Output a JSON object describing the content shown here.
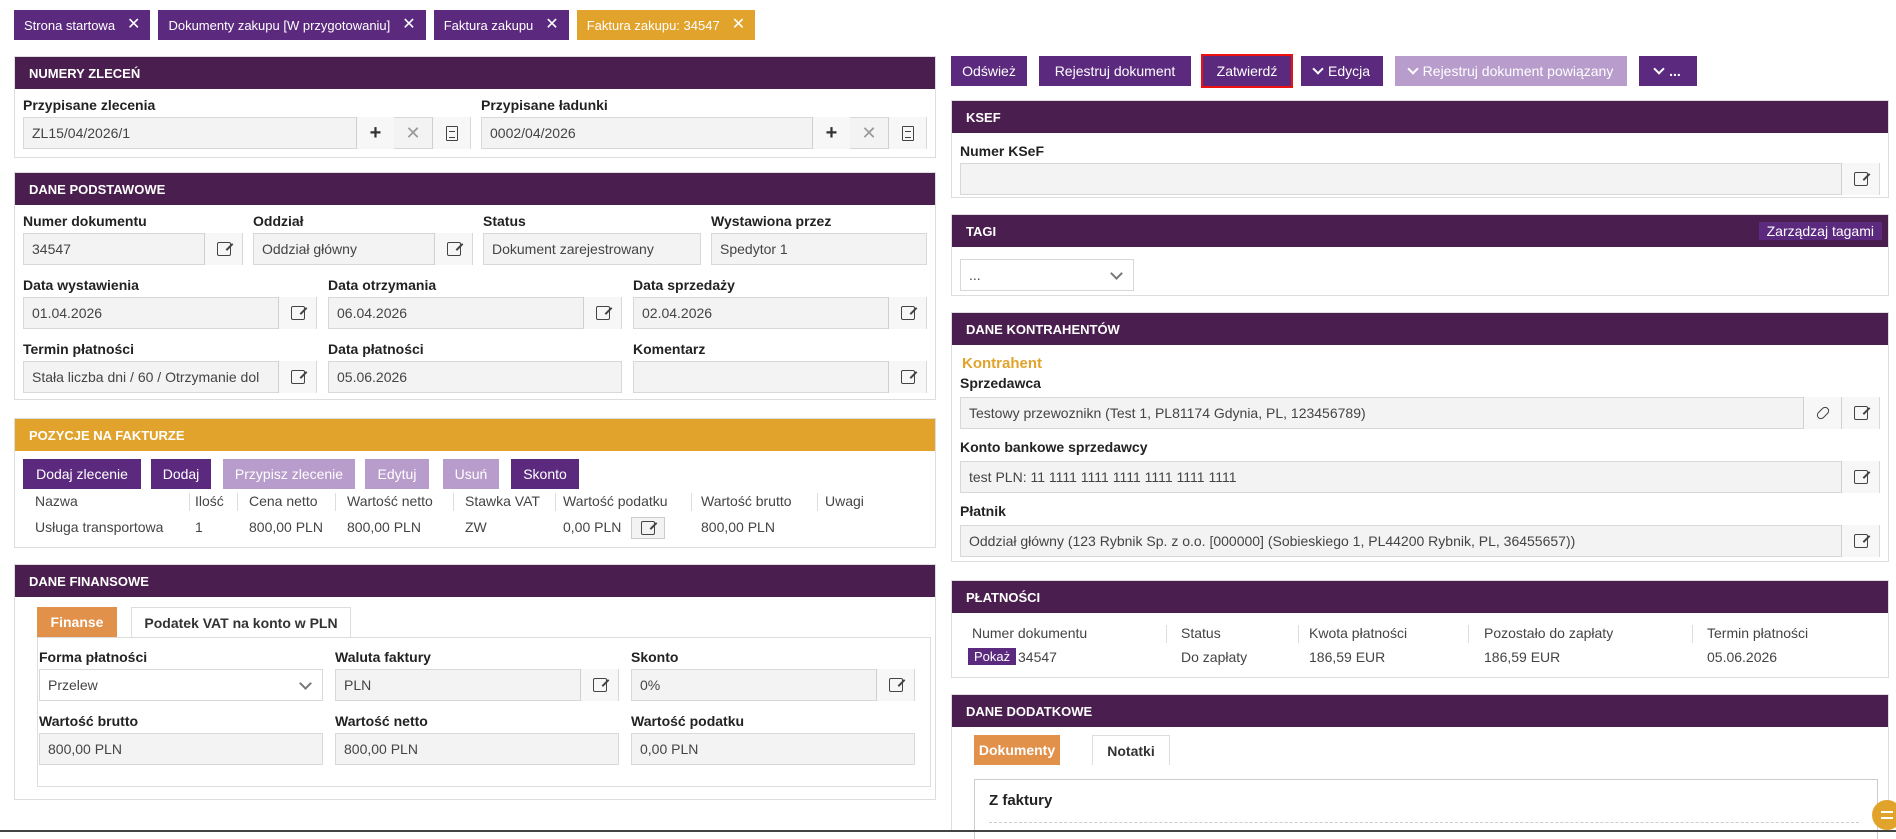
{
  "tabs": [
    {
      "label": "Strona startowa"
    },
    {
      "label": "Dokumenty zakupu [W przygotowaniu]"
    },
    {
      "label": "Faktura zakupu"
    },
    {
      "label": "Faktura zakupu: 34547"
    }
  ],
  "close_glyph": "✕",
  "numery": {
    "title": "NUMERY ZLECEŃ",
    "zlecenia_label": "Przypisane zlecenia",
    "zlecenia_value": "ZL15/04/2026/1",
    "ladunki_label": "Przypisane ładunki",
    "ladunki_value": "0002/04/2026"
  },
  "podstawowe": {
    "title": "DANE PODSTAWOWE",
    "numer_label": "Numer dokumentu",
    "numer_value": "34547",
    "oddzial_label": "Oddział",
    "oddzial_value": "Oddział główny",
    "status_label": "Status",
    "status_value": "Dokument zarejestrowany",
    "wystawiona_label": "Wystawiona przez",
    "wystawiona_value": "Spedytor 1",
    "dw_label": "Data wystawienia",
    "dw_value": "01.04.2026",
    "do_label": "Data otrzymania",
    "do_value": "06.04.2026",
    "ds_label": "Data sprzedaży",
    "ds_value": "02.04.2026",
    "tp_label": "Termin płatności",
    "tp_value": "Stała liczba dni / 60 / Otrzymanie dol",
    "dp_label": "Data płatności",
    "dp_value": "05.06.2026",
    "kom_label": "Komentarz",
    "kom_value": ""
  },
  "pozycje": {
    "title": "POZYCJE NA FAKTURZE",
    "buttons": [
      "Dodaj zlecenie",
      "Dodaj",
      "Przypisz zlecenie",
      "Edytuj",
      "Usuń",
      "Skonto"
    ],
    "headers": [
      "Nazwa",
      "Ilość",
      "Cena netto",
      "Wartość netto",
      "Stawka VAT",
      "Wartość podatku",
      "Wartość brutto",
      "Uwagi"
    ],
    "row": [
      "Usługa transportowa",
      "1",
      "800,00 PLN",
      "800,00 PLN",
      "ZW",
      "0,00 PLN",
      "800,00 PLN",
      ""
    ]
  },
  "finansowe": {
    "title": "DANE FINANSOWE",
    "tab1": "Finanse",
    "tab2": "Podatek VAT na konto w PLN",
    "forma_label": "Forma płatności",
    "forma_value": "Przelew",
    "waluta_label": "Waluta faktury",
    "waluta_value": "PLN",
    "skonto_label": "Skonto",
    "skonto_value": "0%",
    "brutto_label": "Wartość brutto",
    "brutto_value": "800,00 PLN",
    "netto_label": "Wartość netto",
    "netto_value": "800,00 PLN",
    "podatek_label": "Wartość podatku",
    "podatek_value": "0,00 PLN"
  },
  "toolbar": {
    "odswiez": "Odśwież",
    "rejestruj": "Rejestruj dokument",
    "zatwierdz": "Zatwierdź",
    "edycja": "Edycja",
    "powiazany": "Rejestruj dokument powiązany",
    "more": "..."
  },
  "ksef": {
    "title": "KSEF",
    "label": "Numer KSeF",
    "value": ""
  },
  "tagi": {
    "title": "TAGI",
    "manage": "Zarządzaj tagami",
    "select": "..."
  },
  "kontrahenci": {
    "title": "DANE KONTRAHENTÓW",
    "section": "Kontrahent",
    "sprzedawca_label": "Sprzedawca",
    "sprzedawca_value": "Testowy przewoznikn (Test 1, PL81174 Gdynia, PL, 123456789)",
    "konto_label": "Konto bankowe sprzedawcy",
    "konto_value": "test PLN: 11 1111 1111 1111 1111 1111 1111",
    "platnik_label": "Płatnik",
    "platnik_value": "Oddział główny (123 Rybnik Sp. z o.o. [000000] (Sobieskiego 1, PL44200 Rybnik, PL, 36455657))"
  },
  "platnosci": {
    "title": "PŁATNOŚCI",
    "headers": [
      "Numer dokumentu",
      "Status",
      "Kwota płatności",
      "Pozostało do zapłaty",
      "Termin płatności"
    ],
    "show": "Pokaż",
    "row": [
      "34547",
      "Do zapłaty",
      "186,59 EUR",
      "186,59 EUR",
      "05.06.2026"
    ]
  },
  "dodatkowe": {
    "title": "DANE DODATKOWE",
    "tab1": "Dokumenty",
    "tab2": "Notatki",
    "section": "Z faktury"
  }
}
